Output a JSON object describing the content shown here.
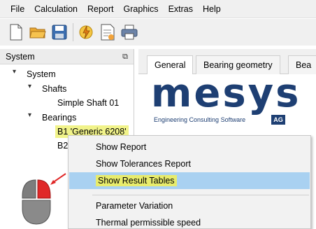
{
  "menubar": {
    "items": [
      "File",
      "Calculation",
      "Report",
      "Graphics",
      "Extras",
      "Help"
    ]
  },
  "toolbar": {
    "icons": [
      "new-file-icon",
      "open-folder-icon",
      "save-icon",
      "calculate-icon",
      "report-icon",
      "print-icon"
    ]
  },
  "system_panel": {
    "title": "System",
    "tree": {
      "system": "System",
      "shafts": "Shafts",
      "shaft_item": "Simple Shaft 01",
      "bearings": "Bearings",
      "bearing_b1": "B1 'Generic 6208'",
      "bearing_b2": "B2"
    }
  },
  "tabs": [
    "General",
    "Bearing geometry",
    "Bea"
  ],
  "logo": {
    "word": "mesys",
    "subtitle": "Engineering Consulting Software",
    "suffix": "AG"
  },
  "context_menu": {
    "items": [
      "Show Report",
      "Show Tolerances Report",
      "Show Result Tables",
      "Parameter Variation",
      "Thermal permissible speed"
    ],
    "selected": "Show Result Tables"
  },
  "colors": {
    "highlight": "#f1f38a",
    "selection": "#a9d1f1",
    "logo": "#1e3f73",
    "mouse_button": "#e02828"
  }
}
